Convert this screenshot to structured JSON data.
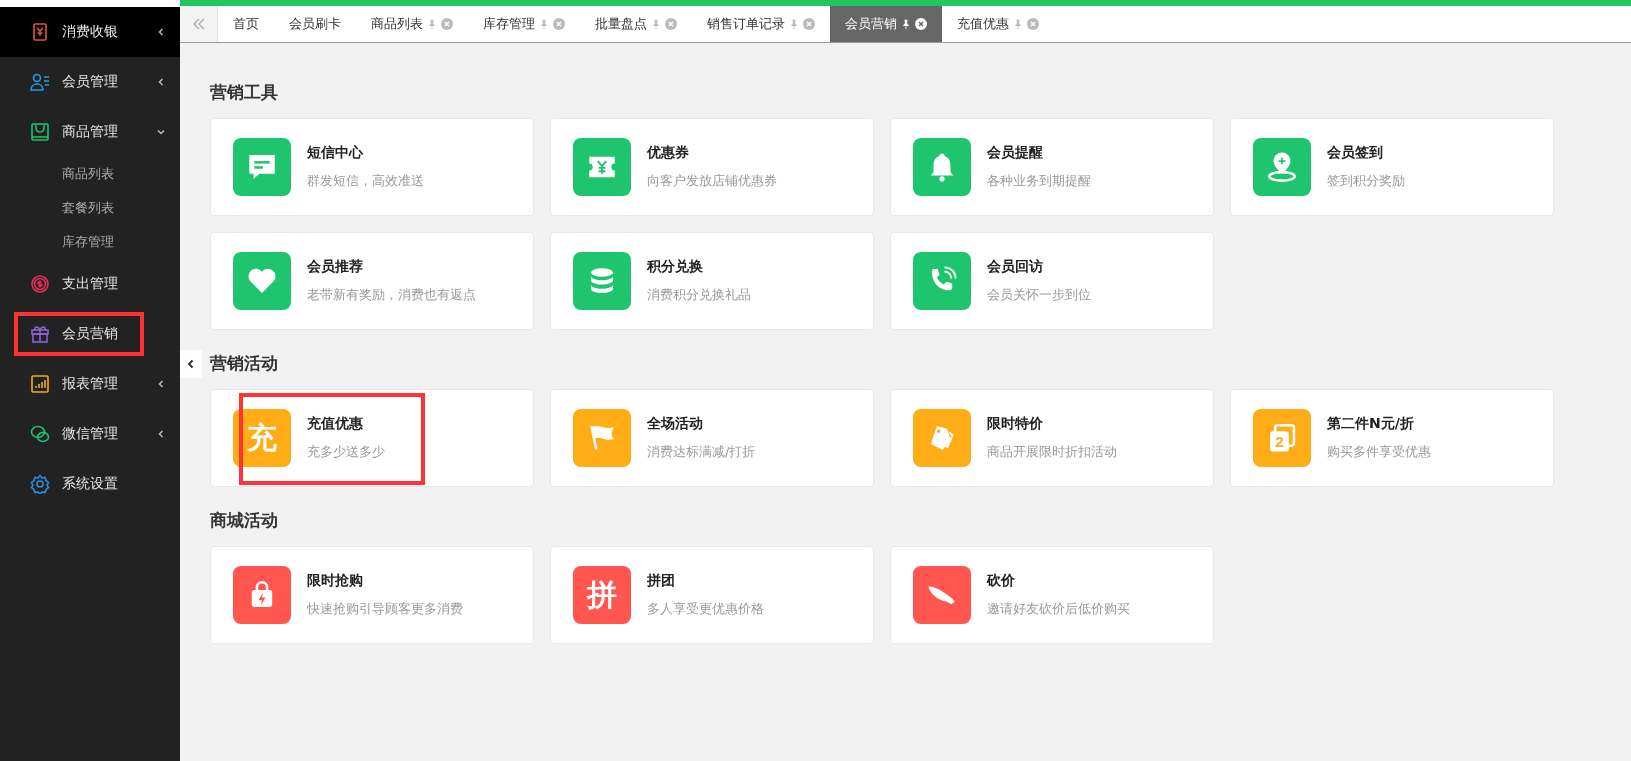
{
  "sidebar": {
    "items": [
      {
        "label": "消费收银",
        "selected": true,
        "highlighted": false,
        "expanded": false
      },
      {
        "label": "会员管理",
        "selected": false,
        "highlighted": false,
        "expanded": false
      },
      {
        "label": "商品管理",
        "selected": false,
        "highlighted": false,
        "expanded": true,
        "children": [
          {
            "label": "商品列表"
          },
          {
            "label": "套餐列表"
          },
          {
            "label": "库存管理"
          }
        ]
      },
      {
        "label": "支出管理",
        "selected": false,
        "highlighted": false
      },
      {
        "label": "会员营销",
        "selected": false,
        "highlighted": true
      },
      {
        "label": "报表管理",
        "selected": false,
        "highlighted": false,
        "expanded": false
      },
      {
        "label": "微信管理",
        "selected": false,
        "highlighted": false,
        "expanded": false
      },
      {
        "label": "系统设置",
        "selected": false,
        "highlighted": false
      }
    ]
  },
  "tabs": [
    {
      "label": "首页",
      "selected": false,
      "closable": false
    },
    {
      "label": "会员刷卡",
      "selected": false,
      "closable": false
    },
    {
      "label": "商品列表",
      "selected": false,
      "closable": true
    },
    {
      "label": "库存管理",
      "selected": false,
      "closable": true
    },
    {
      "label": "批量盘点",
      "selected": false,
      "closable": true
    },
    {
      "label": "销售订单记录",
      "selected": false,
      "closable": true
    },
    {
      "label": "会员营销",
      "selected": true,
      "closable": true
    },
    {
      "label": "充值优惠",
      "selected": false,
      "closable": true
    }
  ],
  "sections": [
    {
      "title": "营销工具",
      "color": "#1fc46e",
      "cards": [
        {
          "title": "短信中心",
          "desc": "群发短信，高效准送",
          "highlighted": false
        },
        {
          "title": "优惠券",
          "desc": "向客户发放店铺优惠券",
          "highlighted": false
        },
        {
          "title": "会员提醒",
          "desc": "各种业务到期提醒",
          "highlighted": false
        },
        {
          "title": "会员签到",
          "desc": "签到积分奖励",
          "highlighted": false
        },
        {
          "title": "会员推荐",
          "desc": "老带新有奖励，消费也有返点",
          "highlighted": false
        },
        {
          "title": "积分兑换",
          "desc": "消费积分兑换礼品",
          "highlighted": false
        },
        {
          "title": "会员回访",
          "desc": "会员关怀一步到位",
          "highlighted": false
        }
      ]
    },
    {
      "title": "营销活动",
      "color": "#ffac17",
      "cards": [
        {
          "title": "充值优惠",
          "desc": "充多少送多少",
          "icon_text": "充",
          "highlighted": true
        },
        {
          "title": "全场活动",
          "desc": "消费达标满减/打折",
          "highlighted": false
        },
        {
          "title": "限时特价",
          "desc": "商品开展限时折扣活动",
          "highlighted": false
        },
        {
          "title": "第二件N元/折",
          "desc": "购买多件享受优惠",
          "icon_text": "2",
          "highlighted": false
        }
      ]
    },
    {
      "title": "商城活动",
      "color": "#ff5650",
      "cards": [
        {
          "title": "限时抢购",
          "desc": "快速抢购引导顾客更多消费",
          "highlighted": false
        },
        {
          "title": "拼团",
          "desc": "多人享受更优惠价格",
          "icon_text": "拼",
          "highlighted": false
        },
        {
          "title": "砍价",
          "desc": "邀请好友砍价后低价购买",
          "highlighted": false
        }
      ]
    }
  ]
}
